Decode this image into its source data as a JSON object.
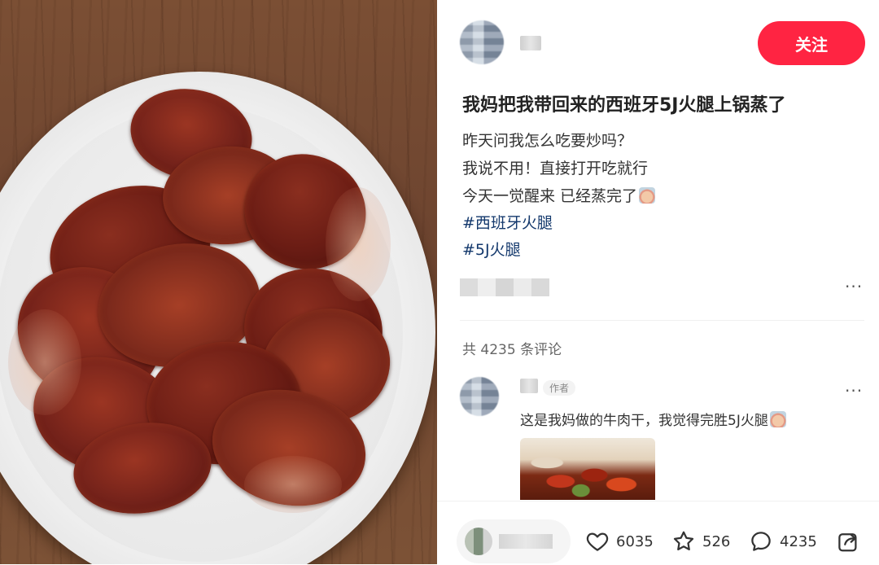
{
  "post": {
    "follow_label": "关注",
    "title": "我妈把我带回来的西班牙5J火腿上锅蒸了",
    "body_lines": [
      "昨天问我怎么吃要炒吗？",
      "我说不用！直接打开吃就行",
      "今天一觉醒来 已经蒸完了"
    ],
    "tags": [
      "#西班牙火腿",
      "#5J火腿"
    ],
    "more_label": "···"
  },
  "comments": {
    "total_label": "共 4235 条评论",
    "first": {
      "author_badge": "作者",
      "text": "这是我妈做的牛肉干，我觉得完胜5J火腿",
      "more_label": "···"
    }
  },
  "toolbar": {
    "likes": "6035",
    "collects": "526",
    "comments": "4235"
  },
  "colors": {
    "accent": "#ff2442",
    "tag": "#13386c"
  },
  "icons": {
    "like": "heart-icon",
    "collect": "star-icon",
    "comment": "speech-bubble-icon",
    "share": "share-icon"
  }
}
